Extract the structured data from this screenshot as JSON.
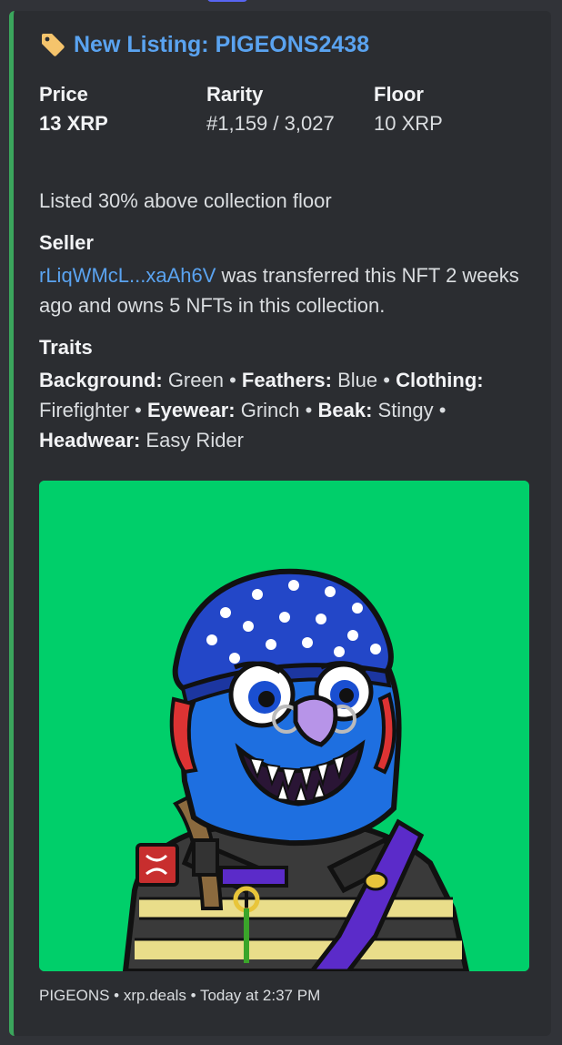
{
  "embed": {
    "title_prefix": "New Listing: ",
    "title_name": "PIGEONS2438",
    "accent_color": "#3ba55c",
    "link_color": "#5aa3f0",
    "fields": [
      {
        "name": "Price",
        "value": "13 XRP"
      },
      {
        "name": "Rarity",
        "value": "#1,159 / 3,027"
      },
      {
        "name": "Floor",
        "value": "10 XRP"
      }
    ],
    "description": "Listed 30% above collection floor",
    "seller": {
      "heading": "Seller",
      "address": "rLiqWMcL...xaAh6V",
      "text": " was transferred this NFT 2 weeks ago and owns 5 NFTs in this collection."
    },
    "traits": {
      "heading": "Traits",
      "items": [
        {
          "key": "Background:",
          "value": "Green"
        },
        {
          "key": "Feathers:",
          "value": "Blue"
        },
        {
          "key": "Clothing:",
          "value": "Firefighter"
        },
        {
          "key": "Eyewear:",
          "value": "Grinch"
        },
        {
          "key": "Beak:",
          "value": "Stingy"
        },
        {
          "key": "Headwear:",
          "value": "Easy Rider"
        }
      ],
      "separator": " • "
    },
    "image": {
      "background_color": "#00cf6a",
      "subject": "pigeon-nft-image"
    },
    "footer": {
      "source": "PIGEONS • xrp.deals",
      "separator": " • ",
      "timestamp": "Today at 2:37 PM"
    }
  }
}
